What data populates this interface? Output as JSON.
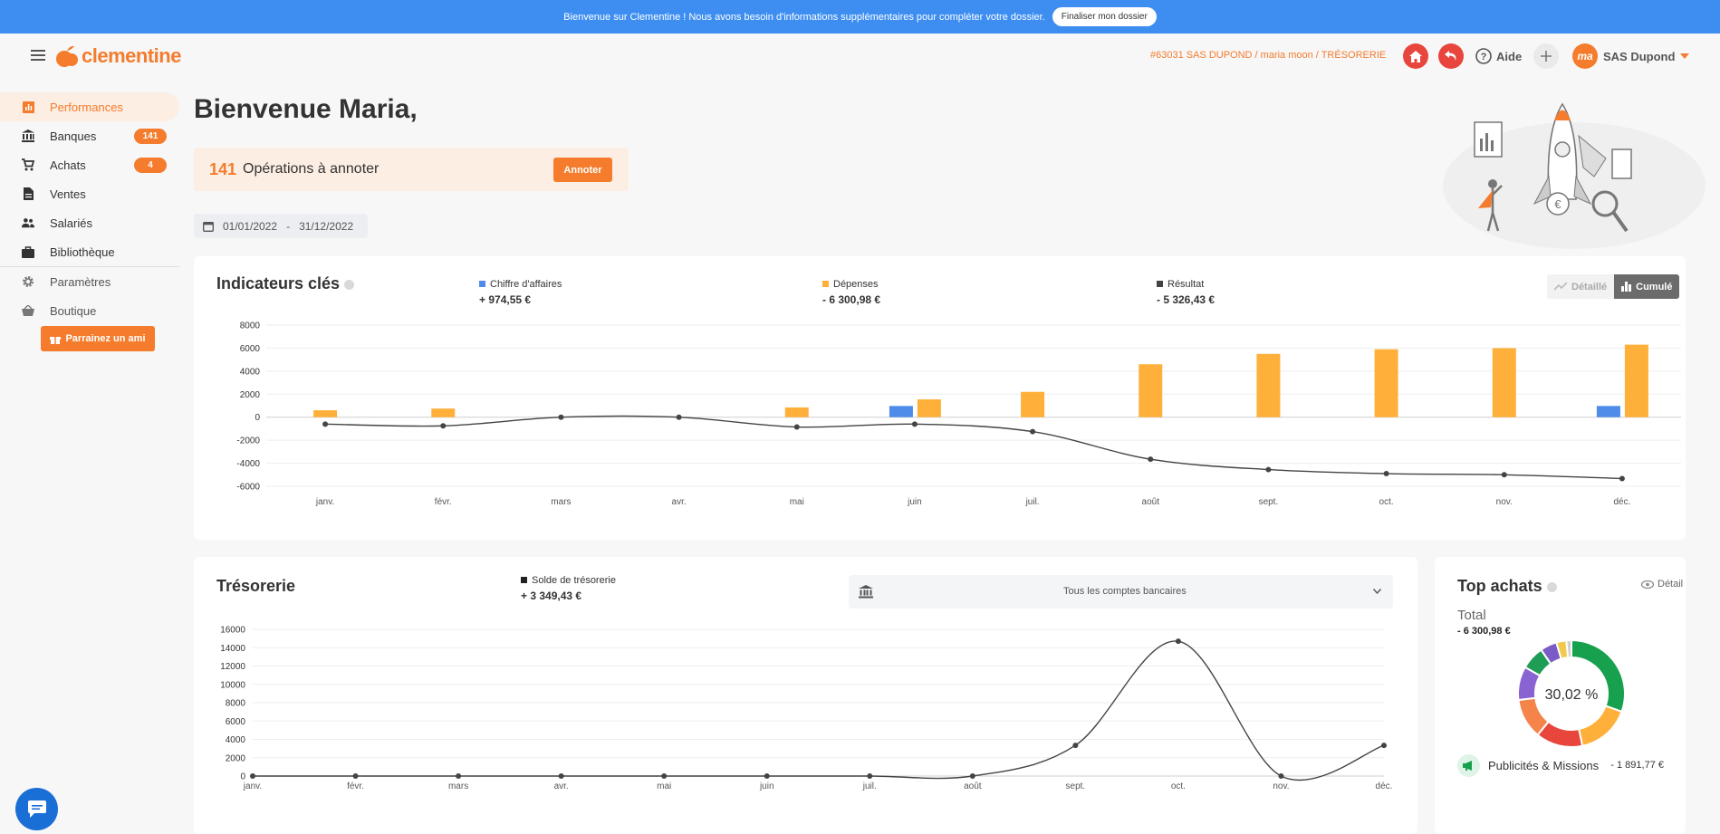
{
  "banner": {
    "message": "Bienvenue sur Clementine ! Nous avons besoin d'informations supplémentaires pour compléter votre dossier.",
    "button": "Finaliser mon dossier"
  },
  "header": {
    "logo_text": "clementine",
    "breadcrumb": "#63031 SAS DUPOND / maria moon / TRÉSORERIE",
    "help_label": "Aide",
    "avatar_initials": "ma",
    "account_name": "SAS Dupond"
  },
  "sidebar": {
    "items": [
      {
        "label": "Performances",
        "icon": "chart-icon",
        "active": true
      },
      {
        "label": "Banques",
        "icon": "bank-icon",
        "badge": "141"
      },
      {
        "label": "Achats",
        "icon": "cart-icon",
        "badge": "4"
      },
      {
        "label": "Ventes",
        "icon": "document-icon"
      },
      {
        "label": "Salariés",
        "icon": "people-icon"
      },
      {
        "label": "Bibliothèque",
        "icon": "briefcase-icon"
      },
      {
        "label": "Paramètres",
        "icon": "gear-icon"
      },
      {
        "label": "Boutique",
        "icon": "basket-icon"
      }
    ],
    "refer_button": "Parrainez un ami"
  },
  "main": {
    "welcome": "Bienvenue Maria,",
    "annotate": {
      "count": "141",
      "label": "Opérations à annoter",
      "button": "Annoter"
    },
    "date_range": {
      "start": "01/01/2022",
      "separator": "-",
      "end": "31/12/2022"
    }
  },
  "indicators": {
    "title": "Indicateurs clés",
    "legend": [
      {
        "name": "Chiffre d'affaires",
        "value": "+ 974,55 €",
        "color": "#4f8be8"
      },
      {
        "name": "Dépenses",
        "value": "- 6 300,98 €",
        "color": "#ffb03b"
      },
      {
        "name": "Résultat",
        "value": "- 5 326,43 €",
        "color": "#444444"
      }
    ],
    "toggle": {
      "detailed": "Détaillé",
      "cumulative": "Cumulé"
    }
  },
  "treasury": {
    "title": "Trésorerie",
    "legend": {
      "name": "Solde de trésorerie",
      "value": "+ 3 349,43 €"
    },
    "account_select": "Tous les comptes bancaires"
  },
  "top_purchases": {
    "title": "Top achats",
    "detail_link": "Détail",
    "total_label": "Total",
    "total_value": "- 6 300,98 €",
    "center_label": "30,02 %",
    "category": {
      "label": "Publicités & Missions",
      "value": "- 1 891,77 €"
    }
  },
  "chart_data": [
    {
      "type": "bar",
      "title": "Indicateurs clés",
      "categories": [
        "janv.",
        "févr.",
        "mars",
        "avr.",
        "mai",
        "juin",
        "juil.",
        "août",
        "sept.",
        "oct.",
        "nov.",
        "déc."
      ],
      "ylim": [
        -6000,
        8000
      ],
      "yticks": [
        8000,
        6000,
        4000,
        2000,
        0,
        -2000,
        -4000,
        -6000
      ],
      "grid": true,
      "series": [
        {
          "name": "Chiffre d'affaires",
          "kind": "bar",
          "color": "#4f8be8",
          "values": [
            0,
            0,
            0,
            0,
            0,
            975,
            975,
            975,
            975,
            975,
            975,
            975
          ]
        },
        {
          "name": "Dépenses",
          "kind": "bar",
          "color": "#ffb03b",
          "values": [
            600,
            750,
            0,
            0,
            850,
            1550,
            2200,
            4600,
            5500,
            5900,
            6000,
            6300
          ]
        },
        {
          "name": "Résultat",
          "kind": "line",
          "color": "#444444",
          "values": [
            -600,
            -750,
            0,
            0,
            -850,
            -600,
            -1250,
            -3650,
            -4550,
            -4900,
            -5000,
            -5330
          ]
        }
      ],
      "bar_visible_from": {
        "Chiffre d'affaires": [
          5,
          11
        ]
      }
    },
    {
      "type": "line",
      "title": "Trésorerie",
      "categories": [
        "janv.",
        "févr.",
        "mars",
        "avr.",
        "mai",
        "juin",
        "juil.",
        "août",
        "sept.",
        "oct.",
        "nov.",
        "déc."
      ],
      "ylim": [
        0,
        16000
      ],
      "yticks": [
        16000,
        14000,
        12000,
        10000,
        8000,
        6000,
        4000,
        2000,
        0
      ],
      "grid": true,
      "series": [
        {
          "name": "Solde de trésorerie",
          "color": "#444444",
          "values": [
            0,
            0,
            0,
            0,
            0,
            0,
            0,
            0,
            3350,
            14700,
            0,
            3350
          ]
        }
      ]
    },
    {
      "type": "pie",
      "title": "Top achats",
      "donut": true,
      "slices": [
        {
          "value": 30.02,
          "color": "#17a04e"
        },
        {
          "value": 16,
          "color": "#ffb03b"
        },
        {
          "value": 14,
          "color": "#e8453c"
        },
        {
          "value": 12,
          "color": "#f4844a"
        },
        {
          "value": 10,
          "color": "#8a63d2"
        },
        {
          "value": 7,
          "color": "#1f9d57"
        },
        {
          "value": 5,
          "color": "#7b5cc6"
        },
        {
          "value": 3,
          "color": "#f2c94c"
        },
        {
          "value": 1.5,
          "color": "#cfcfcf"
        }
      ]
    }
  ]
}
